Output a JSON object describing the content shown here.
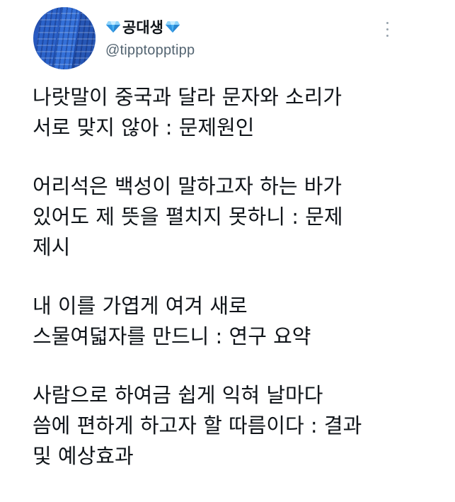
{
  "author": {
    "display_name": "공대생",
    "handle": "@tipptopptipp",
    "avatar_icon": "building-avatar",
    "badge_icon": "blue-diamond-icon",
    "badge_color": "#3aa3f0"
  },
  "menu": {
    "more_icon": "vertical-ellipsis-icon"
  },
  "tweet": {
    "paragraphs": [
      {
        "lines": [
          "나랏말이 중국과 달라 문자와 소리가",
          "서로 맞지 않아 : 문제원인"
        ]
      },
      {
        "lines": [
          "어리석은 백성이 말하고자 하는 바가",
          "있어도 제 뜻을 펼치지 못하니 : 문제",
          "제시"
        ]
      },
      {
        "lines": [
          "내 이를 가엽게 여겨 새로",
          "스물여덟자를 만드니 : 연구 요약"
        ]
      },
      {
        "lines": [
          "사람으로 하여금 쉽게 익혀 날마다",
          "씀에 편하게 하고자 할 따름이다 : 결과",
          "및 예상효과"
        ]
      }
    ]
  }
}
